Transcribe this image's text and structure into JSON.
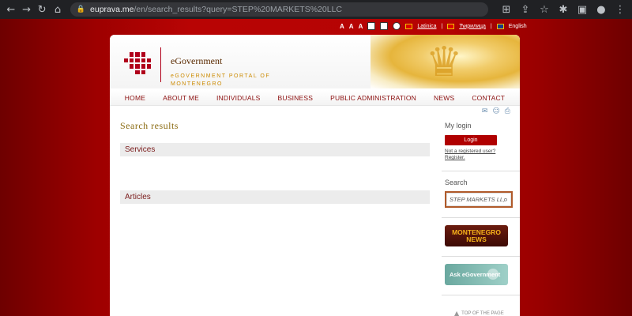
{
  "browser": {
    "url_host": "euprava.me",
    "url_path": "/en/search_results?query=STEP%20MARKETS%20LLC"
  },
  "topbar": {
    "font_sizes": [
      "A",
      "A",
      "A"
    ],
    "lang_latin": "Latinica",
    "lang_cyr": "Ћирилица",
    "lang_en": "English",
    "sep1": "|",
    "sep2": "|"
  },
  "header": {
    "brand": "eGovernment",
    "tagline": "eGOVERNMENT PORTAL OF MONTENEGRO"
  },
  "nav": [
    "HOME",
    "ABOUT ME",
    "INDIVIDUALS",
    "BUSINESS",
    "PUBLIC ADMINISTRATION",
    "NEWS",
    "CONTACT"
  ],
  "content": {
    "title": "Search results",
    "sections": [
      "Services",
      "Articles"
    ]
  },
  "sidebar": {
    "login_title": "My login",
    "login_button": "Login",
    "register_link": "Not a registered user? Register.",
    "search_title": "Search",
    "search_value": "STEP MARKETS LLC",
    "news_banner": "MONTENEGRO NEWS",
    "ask_banner": "Ask eGovernment",
    "top_link": "TOP OF THE PAGE"
  },
  "colors": {
    "accent": "#b00000",
    "background": "#8a0000"
  }
}
